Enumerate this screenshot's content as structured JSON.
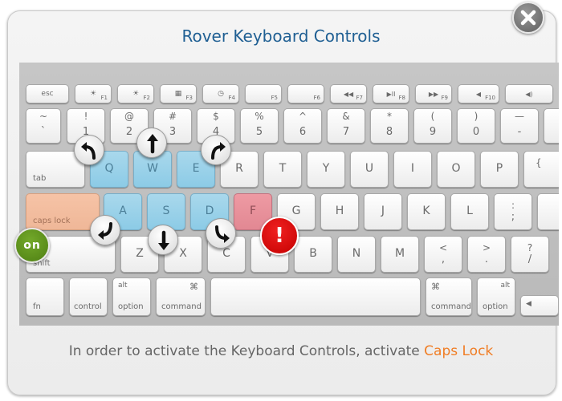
{
  "dialog": {
    "title": "Rover Keyboard Controls",
    "instruction_prefix": "In order to activate the Keyboard Controls, activate ",
    "instruction_highlight": "Caps Lock",
    "on_badge": "on",
    "warning_badge": "!",
    "close_icon": "close-icon"
  },
  "colors": {
    "title": "#1f5f93",
    "highlight": "#f07d24",
    "blue_keys": "#8ccbe6",
    "red_key": "#e28893",
    "orange_key": "#efb798",
    "on_badge": "#5f961e",
    "warning_badge": "#e00000"
  },
  "keyboard": {
    "function_row": [
      {
        "main": "esc",
        "sub": ""
      },
      {
        "main": "☀",
        "sub": "F1"
      },
      {
        "main": "☀",
        "sub": "F2"
      },
      {
        "main": "▦",
        "sub": "F3"
      },
      {
        "main": "◷",
        "sub": "F4"
      },
      {
        "main": "",
        "sub": "F5"
      },
      {
        "main": "",
        "sub": "F6"
      },
      {
        "main": "◀◀",
        "sub": "F7"
      },
      {
        "main": "▶II",
        "sub": "F8"
      },
      {
        "main": "▶▶",
        "sub": "F9"
      },
      {
        "main": "◀",
        "sub": "F10"
      },
      {
        "main": "◀)",
        "sub": ""
      }
    ],
    "number_row": [
      {
        "top": "~",
        "bottom": "`"
      },
      {
        "top": "!",
        "bottom": "1"
      },
      {
        "top": "@",
        "bottom": "2"
      },
      {
        "top": "#",
        "bottom": "3"
      },
      {
        "top": "$",
        "bottom": "4"
      },
      {
        "top": "%",
        "bottom": "5"
      },
      {
        "top": "^",
        "bottom": "6"
      },
      {
        "top": "&",
        "bottom": "7"
      },
      {
        "top": "*",
        "bottom": "8"
      },
      {
        "top": "(",
        "bottom": "9"
      },
      {
        "top": ")",
        "bottom": "0"
      },
      {
        "top": "—",
        "bottom": "-"
      }
    ],
    "qwerty_row": {
      "tab": "tab",
      "letters": [
        "Q",
        "W",
        "E",
        "R",
        "T",
        "Y",
        "U",
        "I",
        "O",
        "P"
      ],
      "last": "{"
    },
    "home_row": {
      "caps_lock": "caps lock",
      "letters": [
        "A",
        "S",
        "D",
        "F",
        "G",
        "H",
        "J",
        "K",
        "L"
      ],
      "last_top": ":",
      "last_bottom": ";"
    },
    "bottom_letter_row": {
      "shift": "shift",
      "letters": [
        "Z",
        "X",
        "C",
        "V",
        "B",
        "N",
        "M"
      ],
      "comma_top": "<",
      "comma_bottom": ",",
      "period_top": ">",
      "period_bottom": ".",
      "slash_top": "?",
      "slash_bottom": "/"
    },
    "space_row": {
      "fn": "fn",
      "control": "control",
      "option_top": "alt",
      "option": "option",
      "command_top": "⌘",
      "command": "command",
      "right_command_top": "⌘",
      "right_command": "command",
      "right_option_top": "alt",
      "right_option": "option",
      "arrow_left": "◀"
    }
  },
  "arrow_overlays": [
    {
      "name": "turn-left-arrow-icon",
      "key": "Q"
    },
    {
      "name": "forward-arrow-icon",
      "key": "W"
    },
    {
      "name": "turn-right-arrow-icon",
      "key": "E"
    },
    {
      "name": "back-left-arrow-icon",
      "key": "A"
    },
    {
      "name": "backward-arrow-icon",
      "key": "S"
    },
    {
      "name": "back-right-arrow-icon",
      "key": "D"
    }
  ]
}
